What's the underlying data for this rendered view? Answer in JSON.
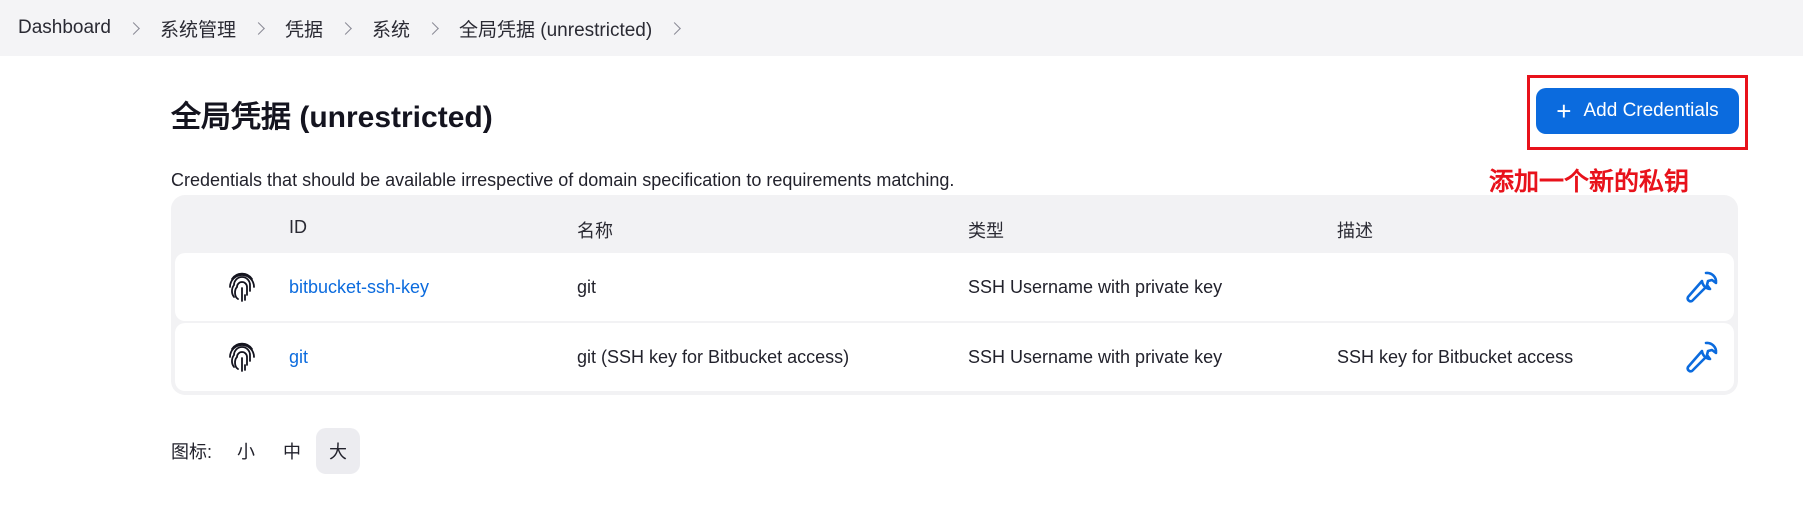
{
  "breadcrumb": [
    "Dashboard",
    "系统管理",
    "凭据",
    "系统",
    "全局凭据 (unrestricted)"
  ],
  "page": {
    "title": "全局凭据 (unrestricted)",
    "description": "Credentials that should be available irrespective of domain specification to requirements matching.",
    "add_button": "Add Credentials",
    "annotation": "添加一个新的私钥"
  },
  "table": {
    "headers": {
      "id": "ID",
      "name": "名称",
      "type": "类型",
      "desc": "描述"
    },
    "rows": [
      {
        "id": "bitbucket-ssh-key",
        "name": "git",
        "type": "SSH Username with private key",
        "desc": "",
        "icon": "fingerprint-icon",
        "action_icon": "wrench-icon"
      },
      {
        "id": "git",
        "name": "git (SSH key for Bitbucket access)",
        "type": "SSH Username with private key",
        "desc": "SSH key for Bitbucket access",
        "icon": "fingerprint-icon",
        "action_icon": "wrench-icon"
      }
    ]
  },
  "icon_size": {
    "label": "图标:",
    "options": [
      "小",
      "中",
      "大"
    ],
    "selected": "大"
  },
  "colors": {
    "accent": "#0b6bde",
    "annotation_red": "#e8121b",
    "breadcrumb_bg": "#f4f4f6"
  }
}
